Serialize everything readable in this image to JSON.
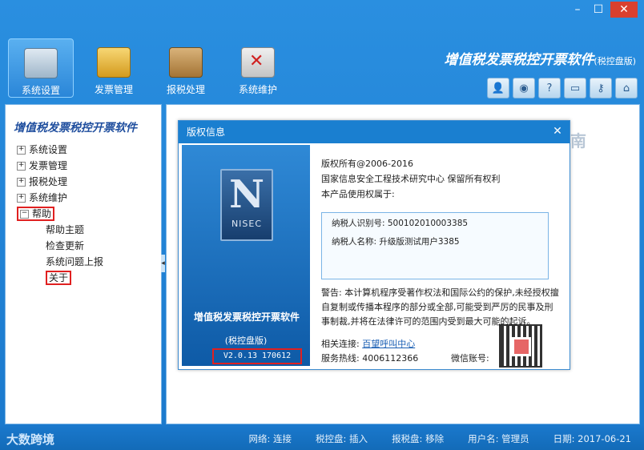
{
  "window": {
    "min": "–",
    "max": "☐",
    "close": "✕"
  },
  "toolbar": [
    {
      "label": "系统设置"
    },
    {
      "label": "发票管理"
    },
    {
      "label": "报税处理"
    },
    {
      "label": "系统维护"
    }
  ],
  "app": {
    "title": "增值税发票税控开票软件",
    "edition": "(税控盘版)"
  },
  "sidebar": {
    "title": "增值税发票税控开票软件",
    "items": [
      {
        "label": "系统设置"
      },
      {
        "label": "发票管理"
      },
      {
        "label": "报税处理"
      },
      {
        "label": "系统维护"
      },
      {
        "label": "帮助"
      }
    ],
    "help_children": [
      {
        "label": "帮助主题"
      },
      {
        "label": "检查更新"
      },
      {
        "label": "系统问题上报"
      },
      {
        "label": "关于"
      }
    ]
  },
  "background_hint": "南",
  "dialog": {
    "title": "版权信息",
    "close": "✕",
    "logo_text": "NISEC",
    "product_name": "增值税发票税控开票软件",
    "product_edition": "(税控盘版)",
    "version": "V2.0.13 170612",
    "copyright": "版权所有@2006-2016",
    "org": "国家信息安全工程技术研究中心 保留所有权利",
    "owner_label": "本产品使用权属于:",
    "taxid_line": "纳税人识别号: 500102010003385",
    "taxname_line": "纳税人名称: 升级版测试用户3385",
    "warning": "警告: 本计算机程序受著作权法和国际公约的保护,未经授权擅自复制或传播本程序的部分或全部,可能受到严厉的民事及刑事制裁,并将在法律许可的范围内受到最大可能的起诉。",
    "link_label": "相关连接:",
    "link_text": "百望呼叫中心",
    "hotline_label": "服务热线: 4006112366",
    "wechat_label": "微信账号:"
  },
  "status": {
    "brand": "大数跨境",
    "network": "网络: 连接",
    "tax_disk": "税控盘: 插入",
    "report_disk": "报税盘: 移除",
    "user": "用户名: 管理员",
    "date": "日期: 2017-06-21"
  }
}
